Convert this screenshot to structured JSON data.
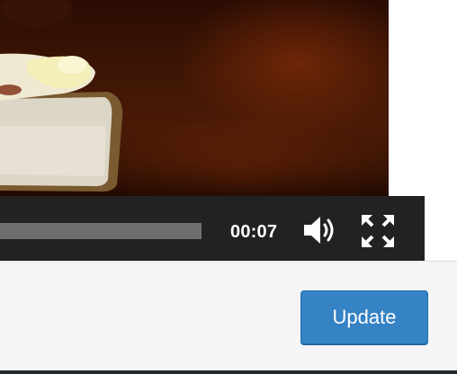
{
  "player": {
    "time": "00:07",
    "progress_fraction": 1.0,
    "volume_icon": "speaker-icon",
    "fullscreen_icon": "fullscreen-icon"
  },
  "footer": {
    "update_label": "Update"
  },
  "colors": {
    "controls_bg": "#222222",
    "button_blue": "#3582c4",
    "footer_bg": "#f5f5f5"
  }
}
